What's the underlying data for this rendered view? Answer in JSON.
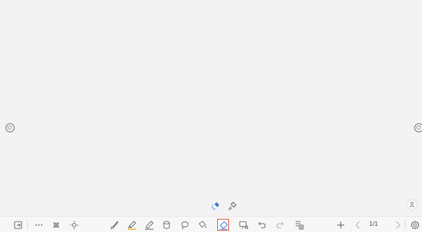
{
  "pager": {
    "label": "1/1"
  },
  "colors": {
    "active_border": "#e0453a",
    "icon": "#6b6b6b",
    "accent_blue": "#3a7bd5",
    "accent_yellow": "#f0b429"
  },
  "toolbar": {
    "items": [
      "exit-icon",
      "more-icon",
      "select-icon",
      "move-icon",
      "brush-icon",
      "highlighter-icon",
      "pen-icon",
      "shape-icon",
      "lasso-icon",
      "fill-icon",
      "eraser-icon",
      "screen-capture-icon",
      "undo-icon",
      "redo-icon",
      "page-list-icon",
      "add-page-icon",
      "prev-page-icon",
      "next-page-icon",
      "settings-icon"
    ],
    "active_item": "eraser-icon"
  },
  "eraser_options": [
    "point-eraser-icon",
    "stroke-eraser-icon"
  ]
}
